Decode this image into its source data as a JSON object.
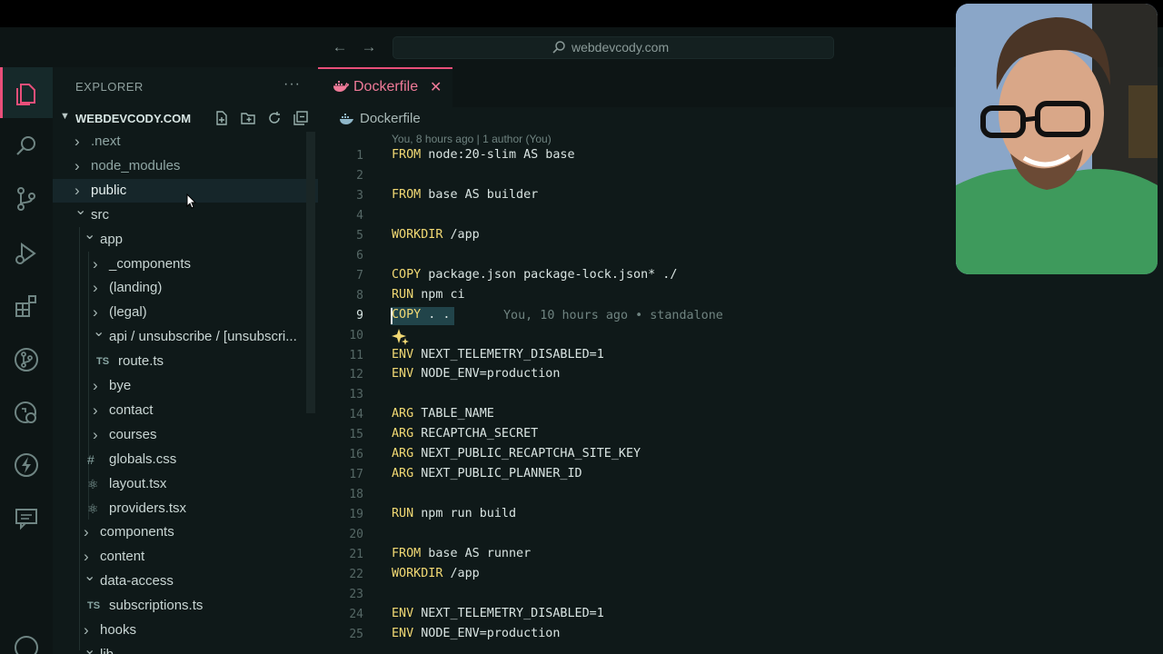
{
  "search": {
    "text": "webdevcody.com"
  },
  "sidebar": {
    "title": "EXPLORER",
    "more": "···",
    "root": "WEBDEVCODY.COM",
    "items": [
      {
        "label": ".next",
        "depth": 0,
        "type": "folder",
        "open": false,
        "color": "#8fa6a4"
      },
      {
        "label": "node_modules",
        "depth": 0,
        "type": "folder",
        "open": false,
        "color": "#8fa6a4"
      },
      {
        "label": "public",
        "depth": 0,
        "type": "folder",
        "open": false,
        "color": "#e6f0ef"
      },
      {
        "label": "src",
        "depth": 0,
        "type": "folder",
        "open": true,
        "color": "#c9d6d4"
      },
      {
        "label": "app",
        "depth": 1,
        "type": "folder",
        "open": true,
        "color": "#c9d6d4"
      },
      {
        "label": "_components",
        "depth": 2,
        "type": "folder",
        "open": false,
        "color": "#c9d6d4"
      },
      {
        "label": "(landing)",
        "depth": 2,
        "type": "folder",
        "open": false,
        "color": "#c9d6d4"
      },
      {
        "label": "(legal)",
        "depth": 2,
        "type": "folder",
        "open": false,
        "color": "#c9d6d4"
      },
      {
        "label": "api / unsubscribe / [unsubscri...",
        "depth": 2,
        "type": "folder",
        "open": true,
        "color": "#c9d6d4"
      },
      {
        "label": "route.ts",
        "depth": 3,
        "type": "ts",
        "icon": "TS",
        "color": "#c9d6d4"
      },
      {
        "label": "bye",
        "depth": 2,
        "type": "folder",
        "open": false,
        "color": "#c9d6d4"
      },
      {
        "label": "contact",
        "depth": 2,
        "type": "folder",
        "open": false,
        "color": "#c9d6d4"
      },
      {
        "label": "courses",
        "depth": 2,
        "type": "folder",
        "open": false,
        "color": "#c9d6d4"
      },
      {
        "label": "globals.css",
        "depth": 2,
        "type": "css",
        "icon": "#",
        "color": "#c9d6d4"
      },
      {
        "label": "layout.tsx",
        "depth": 2,
        "type": "tsx",
        "icon": "⚛",
        "color": "#c9d6d4"
      },
      {
        "label": "providers.tsx",
        "depth": 2,
        "type": "tsx",
        "icon": "⚛",
        "color": "#c9d6d4"
      },
      {
        "label": "components",
        "depth": 1,
        "type": "folder",
        "open": false,
        "color": "#c9d6d4"
      },
      {
        "label": "content",
        "depth": 1,
        "type": "folder",
        "open": false,
        "color": "#c9d6d4"
      },
      {
        "label": "data-access",
        "depth": 1,
        "type": "folder",
        "open": true,
        "color": "#c9d6d4"
      },
      {
        "label": "subscriptions.ts",
        "depth": 2,
        "type": "ts",
        "icon": "TS",
        "color": "#c9d6d4"
      },
      {
        "label": "hooks",
        "depth": 1,
        "type": "folder",
        "open": false,
        "color": "#c9d6d4"
      },
      {
        "label": "lib",
        "depth": 1,
        "type": "folder",
        "open": true,
        "color": "#c9d6d4"
      }
    ]
  },
  "editor": {
    "tab_label": "Dockerfile",
    "tab_close": "✕",
    "breadcrumb": "Dockerfile",
    "blame_header": "You, 8 hours ago | 1 author (You)",
    "inline_blame": "You, 10 hours ago • standalone",
    "current_line": 9,
    "lines": [
      {
        "n": "1",
        "kw": "FROM",
        "rest": " node:20-slim AS base"
      },
      {
        "n": "2",
        "kw": "",
        "rest": ""
      },
      {
        "n": "3",
        "kw": "FROM",
        "rest": " base AS builder"
      },
      {
        "n": "4",
        "kw": "",
        "rest": ""
      },
      {
        "n": "5",
        "kw": "WORKDIR",
        "rest": " /app"
      },
      {
        "n": "6",
        "kw": "",
        "rest": ""
      },
      {
        "n": "7",
        "kw": "COPY",
        "rest": " package.json package-lock.json* ./"
      },
      {
        "n": "8",
        "kw": "RUN",
        "rest": " npm ci"
      },
      {
        "n": "9",
        "kw": "COPY",
        "rest": " . ."
      },
      {
        "n": "10",
        "kw": "",
        "rest": ""
      },
      {
        "n": "11",
        "kw": "ENV",
        "rest": " NEXT_TELEMETRY_DISABLED=1"
      },
      {
        "n": "12",
        "kw": "ENV",
        "rest": " NODE_ENV=production"
      },
      {
        "n": "13",
        "kw": "",
        "rest": ""
      },
      {
        "n": "14",
        "kw": "ARG",
        "rest": " TABLE_NAME"
      },
      {
        "n": "15",
        "kw": "ARG",
        "rest": " RECAPTCHA_SECRET"
      },
      {
        "n": "16",
        "kw": "ARG",
        "rest": " NEXT_PUBLIC_RECAPTCHA_SITE_KEY"
      },
      {
        "n": "17",
        "kw": "ARG",
        "rest": " NEXT_PUBLIC_PLANNER_ID"
      },
      {
        "n": "18",
        "kw": "",
        "rest": ""
      },
      {
        "n": "19",
        "kw": "RUN",
        "rest": " npm run build"
      },
      {
        "n": "20",
        "kw": "",
        "rest": ""
      },
      {
        "n": "21",
        "kw": "FROM",
        "rest": " base AS runner"
      },
      {
        "n": "22",
        "kw": "WORKDIR",
        "rest": " /app"
      },
      {
        "n": "23",
        "kw": "",
        "rest": ""
      },
      {
        "n": "24",
        "kw": "ENV",
        "rest": " NEXT_TELEMETRY_DISABLED=1"
      },
      {
        "n": "25",
        "kw": "ENV",
        "rest": " NODE_ENV=production"
      }
    ]
  },
  "activity_icons": [
    "files-icon",
    "search-icon",
    "source-control-icon",
    "run-debug-icon",
    "extensions-icon",
    "git-graph-icon",
    "remote-explorer-icon",
    "lightning-icon",
    "comments-icon",
    "account-icon"
  ],
  "colors": {
    "accent": "#e94f7a",
    "keyword": "#f2d974",
    "background": "#0f1919"
  }
}
